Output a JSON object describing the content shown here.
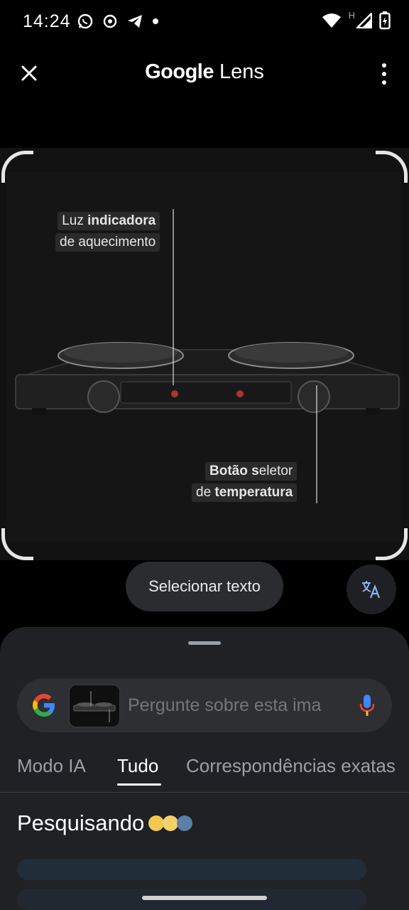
{
  "status": {
    "time": "14:24",
    "icons_left": [
      "whatsapp-icon",
      "lens-notify-icon",
      "telegram-icon",
      "dot-icon"
    ],
    "icons_right": [
      "wifi-icon",
      "signal-icon",
      "battery-charging-icon"
    ],
    "network_label": "H"
  },
  "topbar": {
    "title_bold": "Google",
    "title_rest": "Lens",
    "icons": [
      "close-icon",
      "more-vert-icon"
    ]
  },
  "image": {
    "callout_top_line1_normal": "Luz ",
    "callout_top_line1_bold": "indicadora",
    "callout_top_line2": "de aquecimento",
    "callout_bottom_line1_bold": "Botão s",
    "callout_bottom_line1_normal": "eletor",
    "callout_bottom_line2_normal": "de ",
    "callout_bottom_line2_bold": "temperatura"
  },
  "actions": {
    "select_text_label": "Selecionar texto",
    "translate_icon": "translate-icon"
  },
  "sheet": {
    "search_placeholder": "Pergunte sobre esta ima",
    "tabs": [
      {
        "label": "Modo IA",
        "active": false
      },
      {
        "label": "Tudo",
        "active": true
      },
      {
        "label": "Correspondências exatas",
        "active": false
      }
    ],
    "searching_label": "Pesquisando"
  },
  "colors": {
    "background": "#000000",
    "sheet": "#1f2125",
    "accent_blue": "#4285F4",
    "accent_red": "#EA4335",
    "accent_yellow": "#FBBC05",
    "accent_green": "#34A853"
  }
}
